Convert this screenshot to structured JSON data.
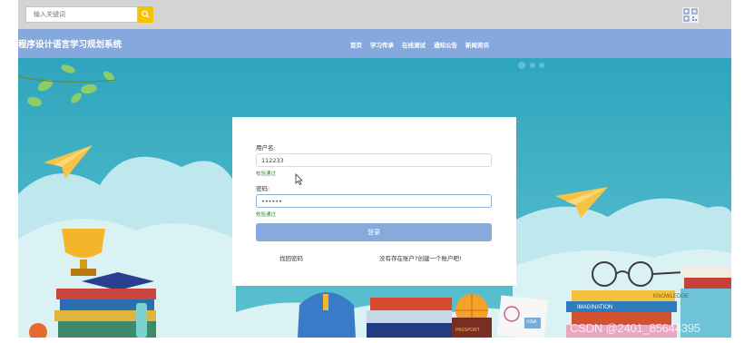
{
  "header": {
    "search": {
      "placeholder": "输入关键词",
      "icon": "search-icon"
    },
    "qr_icon": "qr-code-icon"
  },
  "site": {
    "title": "程序设计语言学习规划系统",
    "nav": [
      "首页",
      "学习传承",
      "在线测试",
      "通知公告",
      "新闻资讯"
    ]
  },
  "login": {
    "username_label": "用户名:",
    "username_value": "112233",
    "username_status": "校验通过",
    "password_label": "密码:",
    "password_value": "••••••",
    "password_status": "校验通过",
    "submit_label": "登录",
    "forgot_link": "找回密码",
    "register_link": "没有存在账户?创建一个账户吧!"
  },
  "illustration": {
    "book_labels": [
      "KNOWLEDGE",
      "IMAGINATION",
      "PASSPORT",
      "VISA"
    ]
  },
  "watermark": "CSDN @2401_85644395",
  "colors": {
    "navbar": "#85a8dd",
    "sky": "#4bb3c6",
    "search_button": "#f5c400",
    "login_button": "#87a9dc",
    "valid_text": "#2e8b2e"
  }
}
